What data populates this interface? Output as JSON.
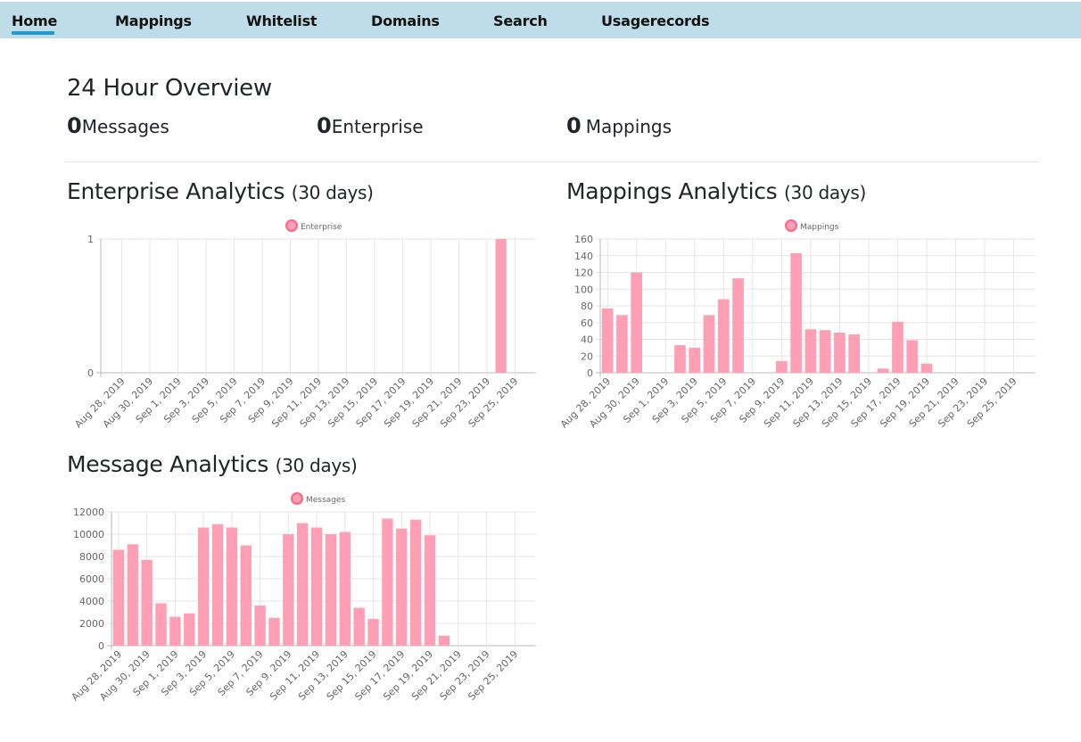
{
  "nav": {
    "items": [
      "Home",
      "Mappings",
      "Whitelist",
      "Domains",
      "Search",
      "Usagerecords"
    ],
    "active": "Home"
  },
  "overview": {
    "title": "24 Hour Overview",
    "messages": {
      "value": "0",
      "label": "Messages"
    },
    "enterprise": {
      "value": "0",
      "label": "Enterprise"
    },
    "mappings": {
      "value": "0",
      "label": "Mappings"
    }
  },
  "sections": {
    "enterprise": {
      "title": "Enterprise Analytics",
      "subtitle": "(30 days)"
    },
    "mappings": {
      "title": "Mappings Analytics",
      "subtitle": "(30 days)"
    },
    "messages": {
      "title": "Message Analytics",
      "subtitle": "(30 days)"
    }
  },
  "colors": {
    "nav_bg": "#bfdde8",
    "nav_active": "#1b9ad6",
    "bar_fill": "#ff9fb5",
    "legend_stroke": "#ff6384",
    "grid": "#e5e5e5",
    "axis": "#666666"
  },
  "chart_data": [
    {
      "id": "enterprise",
      "type": "bar",
      "legend": "Enterprise",
      "legend_position": "top",
      "grid": true,
      "ylim": [
        0,
        1
      ],
      "yticks": [
        0,
        1
      ],
      "tick_labels": [
        "Aug 28, 2019",
        "Aug 30, 2019",
        "Sep 1, 2019",
        "Sep 3, 2019",
        "Sep 5, 2019",
        "Sep 7, 2019",
        "Sep 9, 2019",
        "Sep 11, 2019",
        "Sep 13, 2019",
        "Sep 15, 2019",
        "Sep 17, 2019",
        "Sep 19, 2019",
        "Sep 21, 2019",
        "Sep 23, 2019",
        "Sep 25, 2019"
      ],
      "categories": [
        "Aug 27, 2019",
        "Aug 28, 2019",
        "Aug 29, 2019",
        "Aug 30, 2019",
        "Aug 31, 2019",
        "Sep 1, 2019",
        "Sep 2, 2019",
        "Sep 3, 2019",
        "Sep 4, 2019",
        "Sep 5, 2019",
        "Sep 6, 2019",
        "Sep 7, 2019",
        "Sep 8, 2019",
        "Sep 9, 2019",
        "Sep 10, 2019",
        "Sep 11, 2019",
        "Sep 12, 2019",
        "Sep 13, 2019",
        "Sep 14, 2019",
        "Sep 15, 2019",
        "Sep 16, 2019",
        "Sep 17, 2019",
        "Sep 18, 2019",
        "Sep 19, 2019",
        "Sep 20, 2019",
        "Sep 21, 2019",
        "Sep 22, 2019",
        "Sep 23, 2019",
        "Sep 24, 2019",
        "Sep 25, 2019",
        "Sep 26, 2019"
      ],
      "values": [
        0,
        0,
        0,
        0,
        0,
        0,
        0,
        0,
        0,
        0,
        0,
        0,
        0,
        0,
        0,
        0,
        0,
        0,
        0,
        0,
        0,
        0,
        0,
        0,
        0,
        0,
        0,
        0,
        1,
        0,
        0
      ]
    },
    {
      "id": "mappings",
      "type": "bar",
      "legend": "Mappings",
      "legend_position": "top",
      "grid": true,
      "ylim": [
        0,
        160
      ],
      "yticks": [
        0,
        20,
        40,
        60,
        80,
        100,
        120,
        140,
        160
      ],
      "tick_labels": [
        "Aug 28, 2019",
        "Aug 30, 2019",
        "Sep 1, 2019",
        "Sep 3, 2019",
        "Sep 5, 2019",
        "Sep 7, 2019",
        "Sep 9, 2019",
        "Sep 11, 2019",
        "Sep 13, 2019",
        "Sep 15, 2019",
        "Sep 17, 2019",
        "Sep 19, 2019",
        "Sep 21, 2019",
        "Sep 23, 2019",
        "Sep 25, 2019"
      ],
      "categories": [
        "Aug 28, 2019",
        "Aug 29, 2019",
        "Aug 30, 2019",
        "Aug 31, 2019",
        "Sep 1, 2019",
        "Sep 2, 2019",
        "Sep 3, 2019",
        "Sep 4, 2019",
        "Sep 5, 2019",
        "Sep 6, 2019",
        "Sep 7, 2019",
        "Sep 8, 2019",
        "Sep 9, 2019",
        "Sep 10, 2019",
        "Sep 11, 2019",
        "Sep 12, 2019",
        "Sep 13, 2019",
        "Sep 14, 2019",
        "Sep 15, 2019",
        "Sep 16, 2019",
        "Sep 17, 2019",
        "Sep 18, 2019",
        "Sep 19, 2019",
        "Sep 20, 2019",
        "Sep 21, 2019",
        "Sep 22, 2019",
        "Sep 23, 2019",
        "Sep 24, 2019",
        "Sep 25, 2019",
        "Sep 26, 2019"
      ],
      "values": [
        77,
        69,
        120,
        0,
        0,
        33,
        30,
        69,
        88,
        113,
        0,
        0,
        14,
        143,
        52,
        51,
        48,
        46,
        0,
        5,
        61,
        39,
        11,
        0,
        0,
        0,
        0,
        0,
        0,
        0
      ]
    },
    {
      "id": "messages",
      "type": "bar",
      "legend": "Messages",
      "legend_position": "top",
      "grid": true,
      "ylim": [
        0,
        12000
      ],
      "yticks": [
        0,
        2000,
        4000,
        6000,
        8000,
        10000,
        12000
      ],
      "tick_labels": [
        "Aug 28, 2019",
        "Aug 30, 2019",
        "Sep 1, 2019",
        "Sep 3, 2019",
        "Sep 5, 2019",
        "Sep 7, 2019",
        "Sep 9, 2019",
        "Sep 11, 2019",
        "Sep 13, 2019",
        "Sep 15, 2019",
        "Sep 17, 2019",
        "Sep 19, 2019",
        "Sep 21, 2019",
        "Sep 23, 2019",
        "Sep 25, 2019"
      ],
      "categories": [
        "Aug 28, 2019",
        "Aug 29, 2019",
        "Aug 30, 2019",
        "Aug 31, 2019",
        "Sep 1, 2019",
        "Sep 2, 2019",
        "Sep 3, 2019",
        "Sep 4, 2019",
        "Sep 5, 2019",
        "Sep 6, 2019",
        "Sep 7, 2019",
        "Sep 8, 2019",
        "Sep 9, 2019",
        "Sep 10, 2019",
        "Sep 11, 2019",
        "Sep 12, 2019",
        "Sep 13, 2019",
        "Sep 14, 2019",
        "Sep 15, 2019",
        "Sep 16, 2019",
        "Sep 17, 2019",
        "Sep 18, 2019",
        "Sep 19, 2019",
        "Sep 20, 2019",
        "Sep 21, 2019",
        "Sep 22, 2019",
        "Sep 23, 2019",
        "Sep 24, 2019",
        "Sep 25, 2019",
        "Sep 26, 2019"
      ],
      "values": [
        8600,
        9100,
        7700,
        3800,
        2600,
        2900,
        10600,
        10900,
        10600,
        9000,
        3600,
        2500,
        10000,
        11000,
        10600,
        10000,
        10200,
        3400,
        2400,
        11400,
        10500,
        11300,
        9900,
        900,
        0,
        0,
        0,
        0,
        0,
        0
      ]
    }
  ]
}
